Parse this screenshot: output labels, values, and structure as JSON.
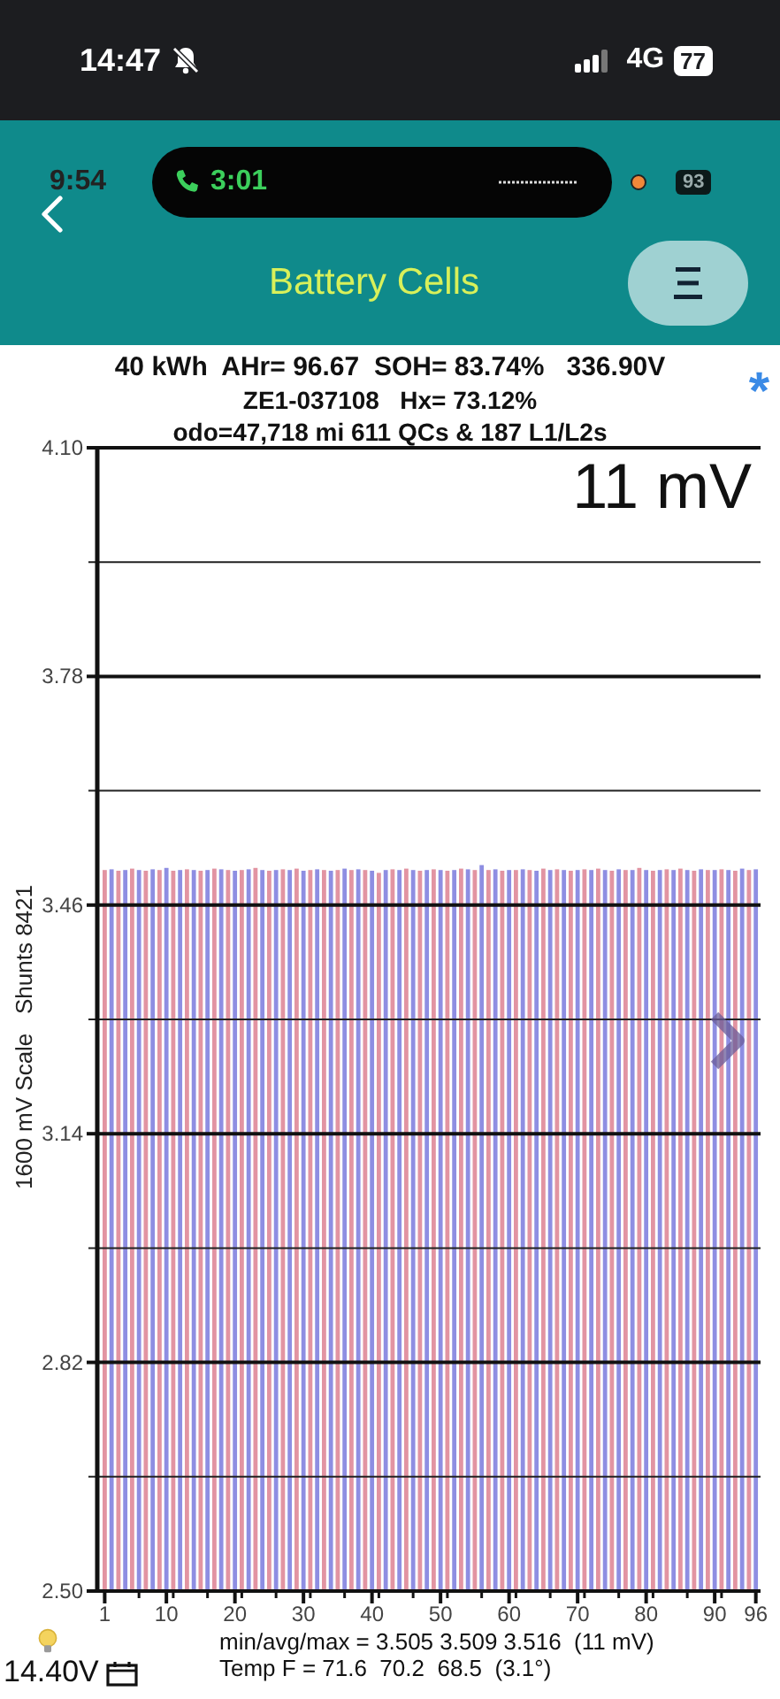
{
  "status_bar": {
    "time": "14:47",
    "network": "4G",
    "battery": "77"
  },
  "call_overlay": {
    "clock": "9:54",
    "call_time": "3:01",
    "badge": "93"
  },
  "app_bar": {
    "title": "Battery Cells"
  },
  "summary": {
    "lines": [
      "40 kWh  AHr= 96.67  SOH= 83.74%   336.90V",
      "ZE1-037108   Hx= 73.12%",
      "odo=47,718 mi 611 QCs & 187 L1/L2s"
    ],
    "marker": "*"
  },
  "chart": {
    "chart_data": {
      "type": "bar",
      "ylabel": "1600 mV Scale   Shunts 8421",
      "x": [
        1,
        2,
        3,
        4,
        5,
        6,
        7,
        8,
        9,
        10,
        11,
        12,
        13,
        14,
        15,
        16,
        17,
        18,
        19,
        20,
        21,
        22,
        23,
        24,
        25,
        26,
        27,
        28,
        29,
        30,
        31,
        32,
        33,
        34,
        35,
        36,
        37,
        38,
        39,
        40,
        41,
        42,
        43,
        44,
        45,
        46,
        47,
        48,
        49,
        50,
        51,
        52,
        53,
        54,
        55,
        56,
        57,
        58,
        59,
        60,
        61,
        62,
        63,
        64,
        65,
        66,
        67,
        68,
        69,
        70,
        71,
        72,
        73,
        74,
        75,
        76,
        77,
        78,
        79,
        80,
        81,
        82,
        83,
        84,
        85,
        86,
        87,
        88,
        89,
        90,
        91,
        92,
        93,
        94,
        95,
        96
      ],
      "series": [
        {
          "color": "#e294a2",
          "values": [
            3.509,
            null,
            3.508,
            null,
            3.511,
            null,
            3.508,
            null,
            3.509,
            null,
            3.508,
            null,
            3.51,
            null,
            3.508,
            null,
            3.511,
            null,
            3.509,
            null,
            3.509,
            null,
            3.512,
            null,
            3.508,
            null,
            3.51,
            null,
            3.511,
            null,
            3.509,
            null,
            3.509,
            null,
            3.509,
            null,
            3.509,
            null,
            3.509,
            null,
            3.505,
            null,
            3.51,
            null,
            3.511,
            null,
            3.508,
            null,
            3.51,
            null,
            3.508,
            null,
            3.511,
            null,
            3.509,
            null,
            3.509,
            null,
            3.508,
            null,
            3.509,
            null,
            3.509,
            null,
            3.511,
            null,
            3.51,
            null,
            3.508,
            null,
            3.51,
            null,
            3.511,
            null,
            3.508,
            null,
            3.509,
            null,
            3.512,
            null,
            3.508,
            null,
            3.51,
            null,
            3.511,
            null,
            3.508,
            null,
            3.509,
            null,
            3.51,
            null,
            3.508,
            null,
            3.509,
            null
          ]
        },
        {
          "color": "#8e8ee2",
          "values": [
            null,
            3.51,
            null,
            3.509,
            null,
            3.509,
            null,
            3.51,
            null,
            3.512,
            null,
            3.509,
            null,
            3.509,
            null,
            3.509,
            null,
            3.51,
            null,
            3.508,
            null,
            3.51,
            null,
            3.509,
            null,
            3.509,
            null,
            3.509,
            null,
            3.508,
            null,
            3.51,
            null,
            3.508,
            null,
            3.511,
            null,
            3.51,
            null,
            3.508,
            null,
            3.509,
            null,
            3.509,
            null,
            3.509,
            null,
            3.509,
            null,
            3.509,
            null,
            3.509,
            null,
            3.51,
            null,
            3.516,
            null,
            3.51,
            null,
            3.509,
            null,
            3.51,
            null,
            3.508,
            null,
            3.509,
            null,
            3.509,
            null,
            3.509,
            null,
            3.509,
            null,
            3.509,
            null,
            3.51,
            null,
            3.509,
            null,
            3.509,
            null,
            3.509,
            null,
            3.509,
            null,
            3.509,
            null,
            3.51,
            null,
            3.509,
            null,
            3.509,
            null,
            3.511,
            null,
            3.51
          ]
        }
      ],
      "xlim": [
        1,
        96
      ],
      "ylim": [
        2.5,
        4.1
      ],
      "grid": true,
      "yticks": [
        {
          "value": 2.5,
          "label": "2.50"
        },
        {
          "value": 2.82,
          "label": "2.82"
        },
        {
          "value": 3.14,
          "label": "3.14"
        },
        {
          "value": 3.46,
          "label": "3.46"
        },
        {
          "value": 3.78,
          "label": "3.78"
        },
        {
          "value": 4.1,
          "label": "4.10"
        }
      ],
      "xticks": [
        1,
        10,
        20,
        30,
        40,
        50,
        60,
        70,
        80,
        90,
        96
      ],
      "annotations": [
        {
          "text": "11 mV"
        }
      ]
    }
  },
  "footer": {
    "voltage": "14.40V",
    "stats": "min/avg/max = 3.505 3.509 3.516  (11 mV)",
    "temperature": "Temp F = 71.6  70.2  68.5  (3.1°)"
  }
}
